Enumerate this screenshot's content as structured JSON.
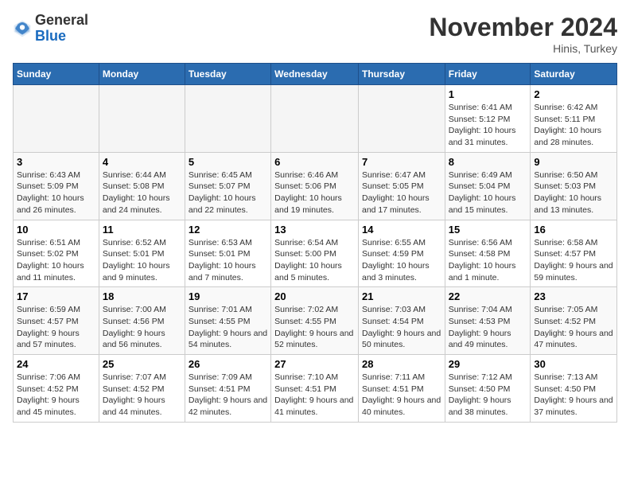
{
  "logo": {
    "general": "General",
    "blue": "Blue"
  },
  "header": {
    "title": "November 2024",
    "subtitle": "Hinis, Turkey"
  },
  "weekdays": [
    "Sunday",
    "Monday",
    "Tuesday",
    "Wednesday",
    "Thursday",
    "Friday",
    "Saturday"
  ],
  "weeks": [
    [
      {
        "day": "",
        "info": ""
      },
      {
        "day": "",
        "info": ""
      },
      {
        "day": "",
        "info": ""
      },
      {
        "day": "",
        "info": ""
      },
      {
        "day": "",
        "info": ""
      },
      {
        "day": "1",
        "info": "Sunrise: 6:41 AM\nSunset: 5:12 PM\nDaylight: 10 hours and 31 minutes."
      },
      {
        "day": "2",
        "info": "Sunrise: 6:42 AM\nSunset: 5:11 PM\nDaylight: 10 hours and 28 minutes."
      }
    ],
    [
      {
        "day": "3",
        "info": "Sunrise: 6:43 AM\nSunset: 5:09 PM\nDaylight: 10 hours and 26 minutes."
      },
      {
        "day": "4",
        "info": "Sunrise: 6:44 AM\nSunset: 5:08 PM\nDaylight: 10 hours and 24 minutes."
      },
      {
        "day": "5",
        "info": "Sunrise: 6:45 AM\nSunset: 5:07 PM\nDaylight: 10 hours and 22 minutes."
      },
      {
        "day": "6",
        "info": "Sunrise: 6:46 AM\nSunset: 5:06 PM\nDaylight: 10 hours and 19 minutes."
      },
      {
        "day": "7",
        "info": "Sunrise: 6:47 AM\nSunset: 5:05 PM\nDaylight: 10 hours and 17 minutes."
      },
      {
        "day": "8",
        "info": "Sunrise: 6:49 AM\nSunset: 5:04 PM\nDaylight: 10 hours and 15 minutes."
      },
      {
        "day": "9",
        "info": "Sunrise: 6:50 AM\nSunset: 5:03 PM\nDaylight: 10 hours and 13 minutes."
      }
    ],
    [
      {
        "day": "10",
        "info": "Sunrise: 6:51 AM\nSunset: 5:02 PM\nDaylight: 10 hours and 11 minutes."
      },
      {
        "day": "11",
        "info": "Sunrise: 6:52 AM\nSunset: 5:01 PM\nDaylight: 10 hours and 9 minutes."
      },
      {
        "day": "12",
        "info": "Sunrise: 6:53 AM\nSunset: 5:01 PM\nDaylight: 10 hours and 7 minutes."
      },
      {
        "day": "13",
        "info": "Sunrise: 6:54 AM\nSunset: 5:00 PM\nDaylight: 10 hours and 5 minutes."
      },
      {
        "day": "14",
        "info": "Sunrise: 6:55 AM\nSunset: 4:59 PM\nDaylight: 10 hours and 3 minutes."
      },
      {
        "day": "15",
        "info": "Sunrise: 6:56 AM\nSunset: 4:58 PM\nDaylight: 10 hours and 1 minute."
      },
      {
        "day": "16",
        "info": "Sunrise: 6:58 AM\nSunset: 4:57 PM\nDaylight: 9 hours and 59 minutes."
      }
    ],
    [
      {
        "day": "17",
        "info": "Sunrise: 6:59 AM\nSunset: 4:57 PM\nDaylight: 9 hours and 57 minutes."
      },
      {
        "day": "18",
        "info": "Sunrise: 7:00 AM\nSunset: 4:56 PM\nDaylight: 9 hours and 56 minutes."
      },
      {
        "day": "19",
        "info": "Sunrise: 7:01 AM\nSunset: 4:55 PM\nDaylight: 9 hours and 54 minutes."
      },
      {
        "day": "20",
        "info": "Sunrise: 7:02 AM\nSunset: 4:55 PM\nDaylight: 9 hours and 52 minutes."
      },
      {
        "day": "21",
        "info": "Sunrise: 7:03 AM\nSunset: 4:54 PM\nDaylight: 9 hours and 50 minutes."
      },
      {
        "day": "22",
        "info": "Sunrise: 7:04 AM\nSunset: 4:53 PM\nDaylight: 9 hours and 49 minutes."
      },
      {
        "day": "23",
        "info": "Sunrise: 7:05 AM\nSunset: 4:52 PM\nDaylight: 9 hours and 47 minutes."
      }
    ],
    [
      {
        "day": "24",
        "info": "Sunrise: 7:06 AM\nSunset: 4:52 PM\nDaylight: 9 hours and 45 minutes."
      },
      {
        "day": "25",
        "info": "Sunrise: 7:07 AM\nSunset: 4:52 PM\nDaylight: 9 hours and 44 minutes."
      },
      {
        "day": "26",
        "info": "Sunrise: 7:09 AM\nSunset: 4:51 PM\nDaylight: 9 hours and 42 minutes."
      },
      {
        "day": "27",
        "info": "Sunrise: 7:10 AM\nSunset: 4:51 PM\nDaylight: 9 hours and 41 minutes."
      },
      {
        "day": "28",
        "info": "Sunrise: 7:11 AM\nSunset: 4:51 PM\nDaylight: 9 hours and 40 minutes."
      },
      {
        "day": "29",
        "info": "Sunrise: 7:12 AM\nSunset: 4:50 PM\nDaylight: 9 hours and 38 minutes."
      },
      {
        "day": "30",
        "info": "Sunrise: 7:13 AM\nSunset: 4:50 PM\nDaylight: 9 hours and 37 minutes."
      }
    ]
  ]
}
